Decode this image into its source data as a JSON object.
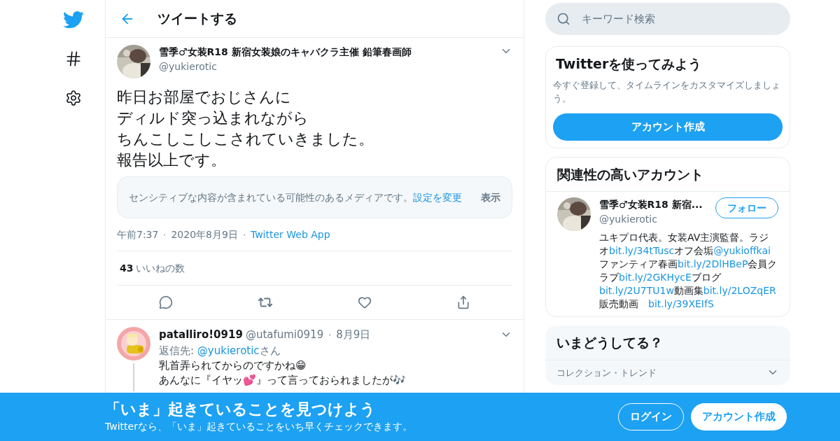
{
  "nav": {
    "items": [
      {
        "kind": "logo"
      },
      {
        "kind": "explore"
      },
      {
        "kind": "settings"
      }
    ]
  },
  "header": {
    "title": "ツイートする"
  },
  "tweet": {
    "name": "雪季♂女装R18 新宿女装娘のキャバクラ主催 鉛筆春画師",
    "handle": "@yukierotic",
    "lines": [
      "昨日お部屋でおじさんに",
      "ディルド突っ込まれながら",
      "ちんこしこしこされていきました。",
      "報告以上です。"
    ],
    "sensitive": {
      "text": "センシティブな内容が含まれている可能性のあるメディアです。",
      "link": "設定を変更",
      "button": "表示"
    },
    "separator": "・",
    "time": "午前7:37",
    "date": "2020年8月9日",
    "source": "Twitter Web App",
    "likes": "43",
    "likes_label": "いいねの数"
  },
  "reply": {
    "name": "patalliro!0919",
    "handle": "@utafumi0919",
    "separator": "・",
    "date": "8月9日",
    "reply_to_label": "返信先:",
    "reply_to": "@yukierotic",
    "reply_to_suffix": "さん",
    "lines": [
      "乳首弄られてからのですかね😁",
      "あんなに『イヤッ💕』って言っておられましたが🎶"
    ]
  },
  "search": {
    "placeholder": "キーワード検索"
  },
  "signup_card": {
    "title": "Twitterを使ってみよう",
    "text": "今すぐ登録して、タイムラインをカスタマイズしましょう。",
    "button": "アカウント作成"
  },
  "related": {
    "title": "関連性の高いアカウント",
    "name": "雪季♂女装R18 新宿...",
    "handle": "@yukierotic",
    "follow": "フォロー",
    "bio": [
      {
        "text": "ユキプロ代表。女装AV主演監督。ラジオ",
        "kind": "text"
      },
      {
        "text": "bit.ly/34tTusc",
        "kind": "link"
      },
      {
        "text": "オフ会垢",
        "kind": "text"
      },
      {
        "text": "@yukioffkai",
        "kind": "link"
      },
      {
        "text": "ファンティア春画",
        "kind": "text"
      },
      {
        "text": "bit.ly/2DlHBeP",
        "kind": "link"
      },
      {
        "text": "会員クラブ",
        "kind": "text"
      },
      {
        "text": "bit.ly/2GKHycE",
        "kind": "link"
      },
      {
        "text": "ブログ",
        "kind": "text"
      },
      {
        "text": "bit.ly/2U7TU1w",
        "kind": "link"
      },
      {
        "text": "動画集",
        "kind": "text"
      },
      {
        "text": "bit.ly/2LOZqER",
        "kind": "link"
      },
      {
        "text": "　販売動画　",
        "kind": "text"
      },
      {
        "text": "bit.ly/39XEIfS",
        "kind": "link"
      }
    ]
  },
  "trends": {
    "title": "いまどうしてる？",
    "subtitle": "コレクション・トレンド"
  },
  "banner": {
    "title": "「いま」起きていることを見つけよう",
    "subtitle": "Twitterなら、「いま」起きていることをいち早くチェックできます。",
    "login": "ログイン",
    "signup": "アカウント作成"
  }
}
